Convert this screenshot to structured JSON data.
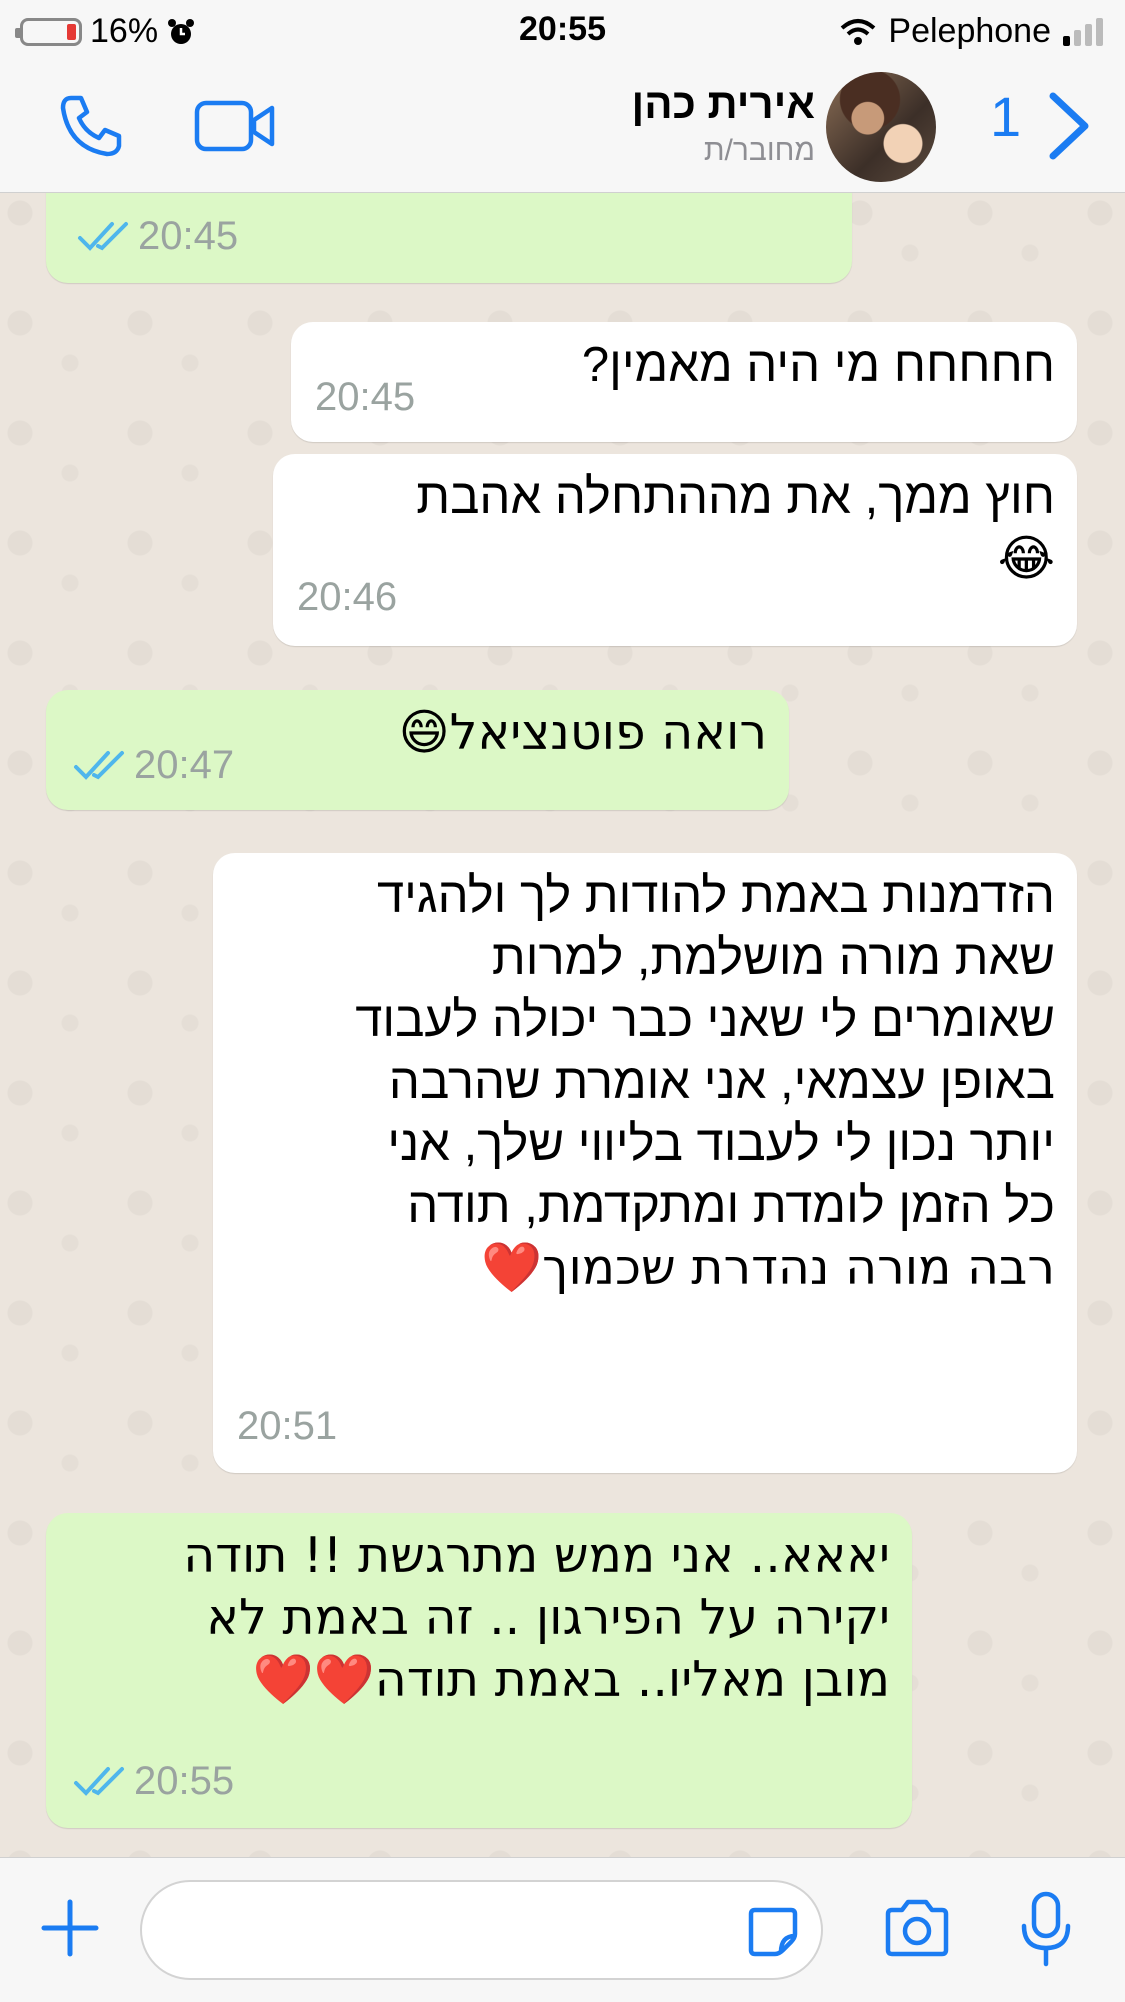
{
  "status_bar": {
    "battery": "16%",
    "time": "20:55",
    "carrier": "Pelephone",
    "alarm_icon": "alarm-clock-icon"
  },
  "header": {
    "back_count": "1",
    "contact_name": "אירית כהן",
    "contact_status": "מחובר/ת",
    "accent_color": "#1b7cf2"
  },
  "messages": [
    {
      "direction": "out",
      "text": "",
      "time": "20:45",
      "ticks": "read"
    },
    {
      "direction": "in",
      "text": "חחחחח מי היה מאמין?",
      "time": "20:45"
    },
    {
      "direction": "in",
      "lines": [
        "חוץ ממך, את מההתחלה אהבת",
        "😂"
      ],
      "time": "20:46"
    },
    {
      "direction": "out",
      "text": "רואה פוטנציאל😄",
      "time": "20:47",
      "ticks": "read"
    },
    {
      "direction": "in",
      "lines": [
        "הזדמנות באמת להודות לך ולהגיד",
        "שאת מורה מושלמת, למרות",
        "שאומרים לי שאני כבר יכולה לעבוד",
        "באופן עצמאי, אני אומרת שהרבה",
        "יותר נכון לי לעבוד בליווי שלך, אני",
        "כל הזמן לומדת ומתקדמת, תודה",
        "רבה מורה נהדרת שכמוך❤️"
      ],
      "time": "20:51"
    },
    {
      "direction": "out",
      "lines": [
        "יאאא.. אני ממש מתרגשת !! תודה",
        "יקירה על הפירגון .. זה באמת לא",
        "מובן מאליו.. באמת תודה❤️❤️"
      ],
      "time": "20:55",
      "ticks": "read"
    }
  ],
  "input": {
    "placeholder": ""
  },
  "colors": {
    "outgoing_bubble": "#dcf8c6",
    "incoming_bubble": "#ffffff",
    "read_ticks": "#4fb6ec"
  }
}
